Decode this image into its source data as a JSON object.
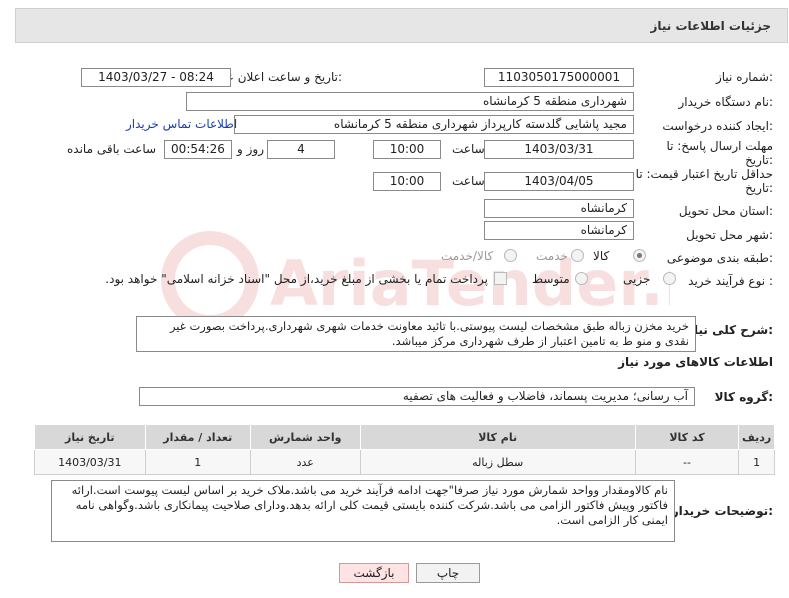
{
  "header": {
    "title": "جزئیات اطلاعات نیاز"
  },
  "form": {
    "need_number": {
      "label": "شماره نیاز:",
      "value": "1103050175000001"
    },
    "announce_datetime": {
      "label": "تاریخ و ساعت اعلان عمومی:",
      "value": "1403/03/27 - 08:24"
    },
    "buyer_org": {
      "label": "نام دستگاه خریدار:",
      "value": "شهرداری منطقه 5 کرمانشاه"
    },
    "requester": {
      "label": "ایجاد کننده درخواست:",
      "value": "مجید پاشایی گلدسته کارپرداز شهرداری منطقه 5 کرمانشاه",
      "contact_link": "اطلاعات تماس خریدار"
    },
    "reply_deadline": {
      "label": "مهلت ارسال پاسخ: تا",
      "label2": "تاریخ:",
      "date": "1403/03/31",
      "time_label": "ساعت",
      "time": "10:00",
      "days": "4",
      "days_label": "روز و",
      "remaining": "00:54:26",
      "remaining_label": "ساعت باقی مانده"
    },
    "price_validity": {
      "label": "حداقل تاریخ اعتبار قیمت: تا",
      "label2": "تاریخ:",
      "date": "1403/04/05",
      "time_label": "ساعت",
      "time": "10:00"
    },
    "province": {
      "label": "استان محل تحویل:",
      "value": "کرمانشاه"
    },
    "city": {
      "label": "شهر محل تحویل:",
      "value": "کرمانشاه"
    },
    "category": {
      "label": "طبقه بندی موضوعی:",
      "options": [
        "کالا",
        "خدمت",
        "کالا/خدمت"
      ],
      "selected": "کالا"
    },
    "purchase_type": {
      "label": "نوع فرآیند خرید :",
      "options": [
        "جزیی",
        "متوسط"
      ],
      "selected": "",
      "payment_note": "پرداخت تمام یا بخشی از مبلغ خرید،از محل \"اسناد خزانه اسلامی\" خواهد بود."
    },
    "general_description": {
      "label": "شرح کلی نیاز:",
      "value": "خرید مخزن زباله طبق مشخصات لیست پیوستی.با تائید معاونت خدمات شهری شهرداری.پرداخت بصورت غیر نقدی و منو ط به تامین اعتبار از طرف شهرداری مرکز میباشد."
    }
  },
  "goods_section": {
    "title": "اطلاعات کالاهای مورد نیاز",
    "group_label": "گروه کالا:",
    "group_value": "آب رسانی؛ مدیریت پسماند، فاضلاب و فعالیت های تصفیه",
    "table": {
      "headers": [
        "ردیف",
        "کد کالا",
        "نام کالا",
        "واحد شمارش",
        "تعداد / مقدار",
        "تاریخ نیاز"
      ],
      "rows": [
        [
          "1",
          "--",
          "سطل زباله",
          "عدد",
          "1",
          "1403/03/31"
        ]
      ]
    }
  },
  "buyer_notes": {
    "label": "توضیحات خریدار:",
    "value": "نام کالاومقدار وواحد شمارش مورد نیاز صرفا\"جهت ادامه فرآیند خرید می باشد.ملاک خرید بر اساس لیست پیوست است.ارائه فاکتور وپیش فاکتور الزامی می باشد.شرکت کننده بایستی قیمت کلی ارائه بدهد.ودارای صلاحیت پیمانکاری باشد.وگواهی نامه ایمنی کار الزامی است."
  },
  "buttons": {
    "print": "چاپ",
    "back": "بازگشت"
  },
  "watermark": {
    "text": "AriaTender.net"
  }
}
